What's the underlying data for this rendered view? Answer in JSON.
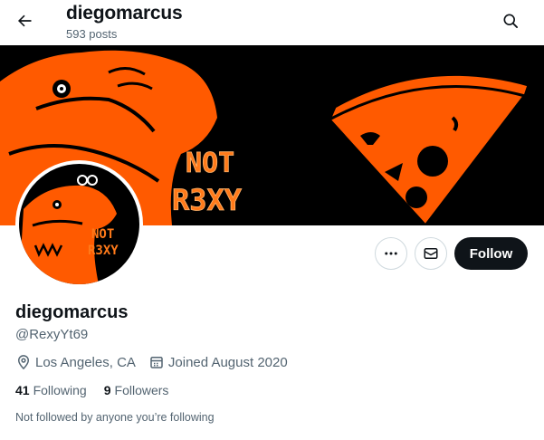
{
  "header": {
    "name": "diegomarcus",
    "posts_count": "593 posts",
    "back_icon": "arrow-left-icon",
    "search_icon": "search-icon"
  },
  "banner": {
    "text_line1": "NOT",
    "text_line2": "R3XY",
    "colors": {
      "background": "#000000",
      "accent": "#ff5a00",
      "glow": "#ffb36b"
    }
  },
  "avatar": {
    "text_line1": "NOT",
    "text_line2": "R3XY"
  },
  "actions": {
    "more_icon": "more-dots-icon",
    "message_icon": "envelope-icon",
    "follow_label": "Follow"
  },
  "profile": {
    "display_name": "diegomarcus",
    "handle": "@RexyYt69",
    "location": "Los Angeles, CA",
    "joined": "Joined August 2020",
    "following_count": "41",
    "following_label": "Following",
    "followers_count": "9",
    "followers_label": "Followers",
    "not_followed_note": "Not followed by anyone you’re following"
  },
  "colors": {
    "text_primary": "#0f1419",
    "text_secondary": "#536471",
    "button_dark": "#0f1419",
    "border": "#cfd9de"
  }
}
